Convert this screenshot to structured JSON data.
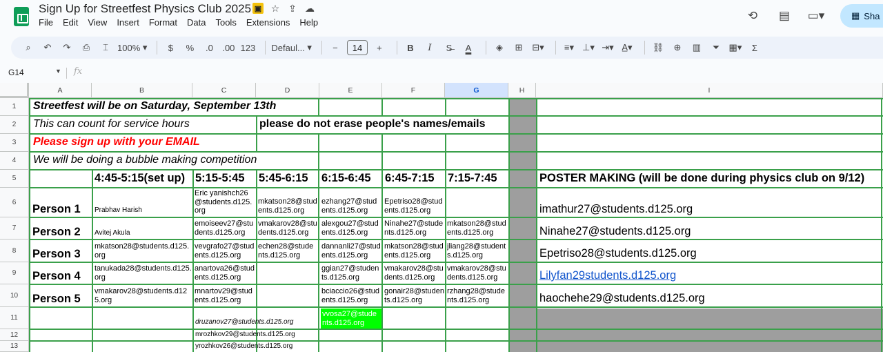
{
  "app": {
    "doc_title": "Sign Up for Streetfest Physics Club 2025",
    "share_label": "Sha",
    "menu": [
      "File",
      "Edit",
      "View",
      "Insert",
      "Format",
      "Data",
      "Tools",
      "Extensions",
      "Help"
    ]
  },
  "toolbar": {
    "zoom": "100%",
    "currency": "$",
    "percent": "%",
    "dec_decrease": ".0",
    "dec_increase": ".00",
    "number_format": "123",
    "font": "Defaul...",
    "font_size": "14",
    "minus": "−",
    "plus": "+",
    "bold": "B",
    "italic": "I",
    "text_color": "A",
    "sum": "Σ"
  },
  "formula_bar": {
    "cell_ref": "G14",
    "fx": "fx"
  },
  "columns": [
    "A",
    "B",
    "C",
    "D",
    "E",
    "F",
    "G",
    "H",
    "I"
  ],
  "selected_column": "G",
  "rows": [
    "1",
    "2",
    "3",
    "4",
    "5",
    "6",
    "7",
    "8",
    "9",
    "10",
    "11",
    "12",
    "13"
  ],
  "sheet": {
    "r1": "Streetfest will be on Saturday, September 13th",
    "r2a": "This can count for service hours",
    "r2d": "please do not erase people's names/emails",
    "r3": "Please sign up with your EMAIL",
    "r4": "We will be doing a bubble making competition",
    "slots": [
      "4:45-5:15(set up)",
      "5:15-5:45",
      "5:45-6:15",
      "6:15-6:45",
      "6:45-7:15",
      "7:15-7:45"
    ],
    "poster_header": "POSTER MAKING (will be done during physics club on 9/12)",
    "persons": [
      "Person 1",
      "Person 2",
      "Person 3",
      "Person 4",
      "Person 5"
    ],
    "r6": {
      "b": "Prabhav Harish",
      "c": "Eric yanishch26@students.d125.org",
      "d": "mkatson28@students.d125.org",
      "e": "ezhang27@students.d125.org",
      "f": "Epetriso28@students.d125.org",
      "i": "imathur27@students.d125.org"
    },
    "r7": {
      "b": "Avitej Akula",
      "c": "emoiseev27@students.d125.org",
      "d": "vmakarov28@students.d125.org",
      "e": "alexgou27@students.d125.org",
      "f": "Ninahe27@students.d125.org",
      "g": "mkatson28@students.d125.org",
      "i": "Ninahe27@students.d125.org"
    },
    "r8": {
      "b": "mkatson28@students.d125.org",
      "c": "vevgrafo27@students.d125.org",
      "d": "echen28@students.d125.org",
      "e": "dannanli27@students.d125.org",
      "f": "mkatson28@students.d125.org",
      "g": "jliang28@students.d125.org",
      "i": "Epetriso28@students.d125.org"
    },
    "r9": {
      "b": "tanukada28@students.d125.org",
      "c": "anartova26@students.d125.org",
      "e": "ggian27@students.d125.org",
      "f": "vmakarov28@students.d125.org",
      "g": "vmakarov28@students.d125.org",
      "i": "Lilyfan29students.d125.org"
    },
    "r10": {
      "b": "vmakarov28@students.d125.org",
      "c": "mnartov29@students.d125.org",
      "e": "bciaccio26@students.d125.org",
      "f": "gonair28@students.d125.org",
      "g": "rzhang28@students.d125.org",
      "i": "haochehe29@students.d125.org"
    },
    "r11": {
      "c": "druzanov27@students.d125.org",
      "e": "vvosa27@students.d125.org"
    },
    "r12": {
      "c": "mrozhkov29@students.d125.org"
    },
    "r13": {
      "c": "yrozhkov26@students.d125.org"
    }
  },
  "colors": {
    "grid_border": "#3aa04a",
    "gray_fill": "#9e9e9e",
    "highlight_green": "#00ff00",
    "red_text": "#ff0000",
    "link": "#1155cc"
  }
}
